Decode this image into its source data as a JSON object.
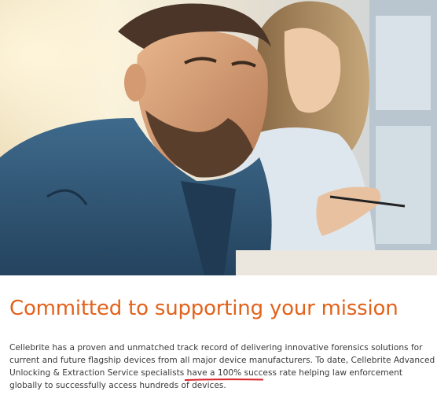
{
  "hero": {
    "image_name": "two-colleagues-working-photo"
  },
  "headline": "Committed to supporting your mission",
  "body": {
    "part1": "Cellebrite has a proven and unmatched track record of delivering innovative forensics solutions for current and future flagship devices from all major device manufacturers. To date, Cellebrite Advanced Unlocking & Extraction Service specialists ",
    "highlight": "have a 100% success rate",
    "part2": " helping law enforcement globally to successfully access hundreds of devices."
  },
  "colors": {
    "headline": "#e2621b",
    "body_text": "#3a3a3a",
    "annotation_underline": "#d9232b"
  }
}
